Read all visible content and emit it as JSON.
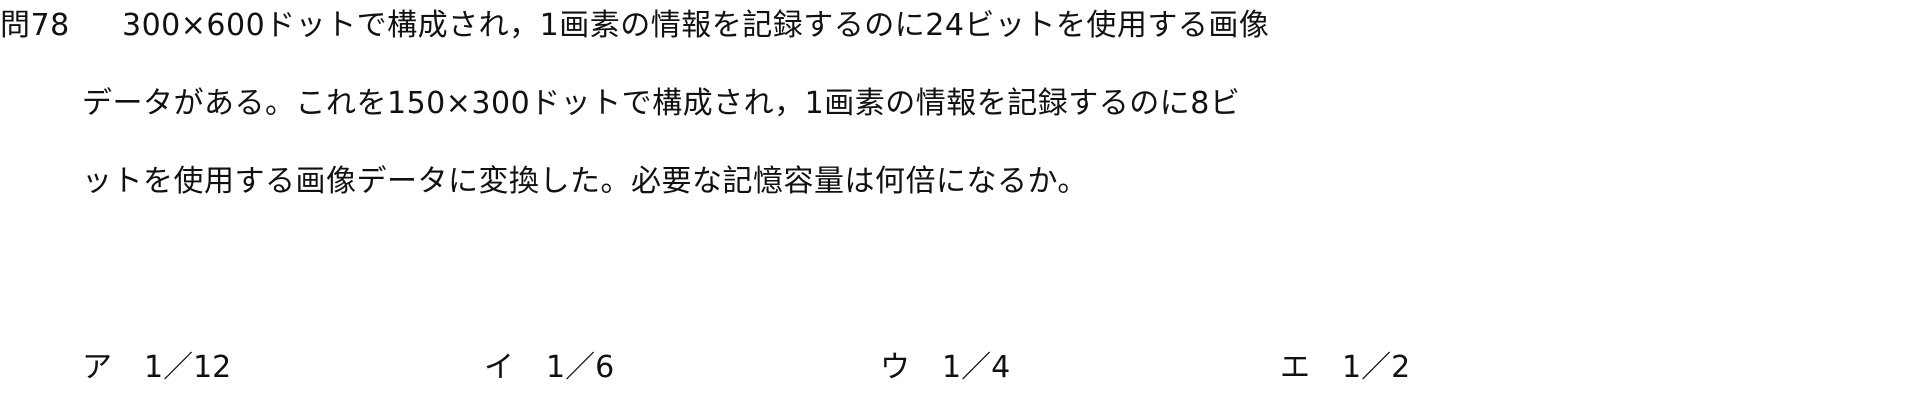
{
  "question": {
    "number": "問78",
    "line1": "300×600ドットで構成され，1画素の情報を記録するのに24ビットを使用する画像",
    "line2": "データがある。これを150×300ドットで構成され，1画素の情報を記録するのに8ビ",
    "line3": "ットを使用する画像データに変換した。必要な記憶容量は何倍になるか。"
  },
  "choices": [
    {
      "mark": "ア",
      "value": "1／12"
    },
    {
      "mark": "イ",
      "value": "1／6"
    },
    {
      "mark": "ウ",
      "value": "1／4"
    },
    {
      "mark": "エ",
      "value": "1／2"
    }
  ]
}
